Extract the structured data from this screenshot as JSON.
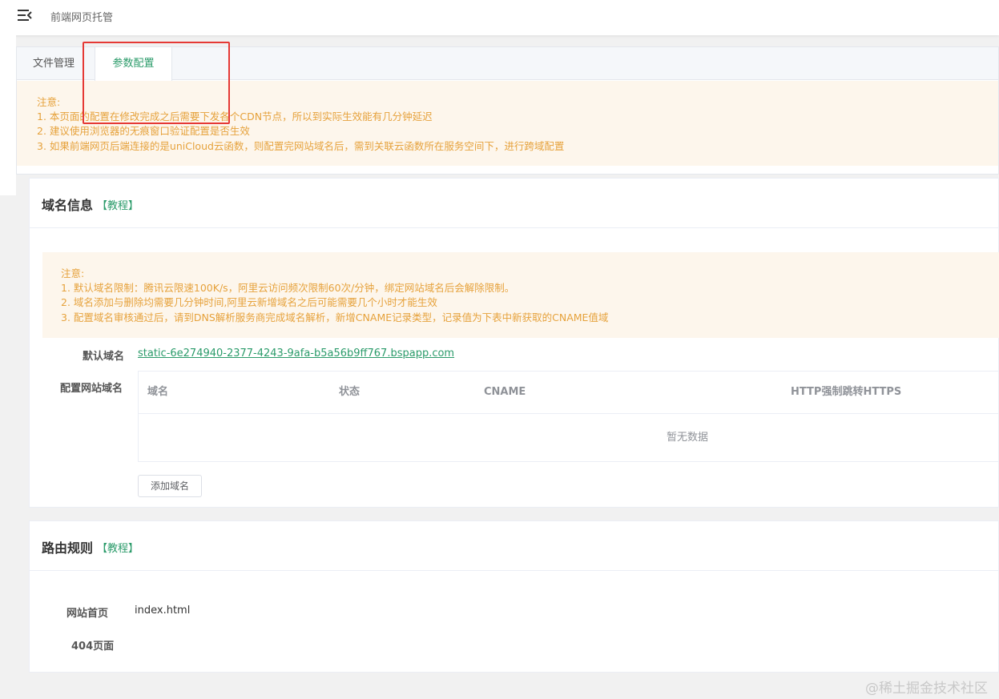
{
  "header": {
    "menu_icon": "menu-fold-icon",
    "breadcrumb": "前端网页托管"
  },
  "tabs": [
    {
      "label": "文件管理",
      "active": false
    },
    {
      "label": "参数配置",
      "active": true
    }
  ],
  "top_notice": {
    "title": "注意:",
    "lines": [
      "1. 本页面的配置在修改完成之后需要下发各个CDN节点，所以到实际生效能有几分钟延迟",
      "2. 建议使用浏览器的无痕窗口验证配置是否生效",
      "3. 如果前端网页后端连接的是uniCloud云函数，则配置完网站域名后，需到关联云函数所在服务空间下，进行跨域配置"
    ]
  },
  "domain_section": {
    "title": "域名信息",
    "tutorial": "【教程】",
    "notice": {
      "title": "注意:",
      "lines": [
        "1. 默认域名限制：腾讯云限速100K/s，阿里云访问频次限制60次/分钟，绑定网站域名后会解除限制。",
        "2. 域名添加与删除均需要几分钟时间,阿里云新增域名之后可能需要几个小时才能生效",
        "3. 配置域名审核通过后，请到DNS解析服务商完成域名解析，新增CNAME记录类型，记录值为下表中新获取的CNAME值域"
      ]
    },
    "default_domain_label": "默认域名",
    "default_domain_value": "static-6e274940-2377-4243-9afa-b5a56b9ff767.bspapp.com",
    "custom_domain_label": "配置网站域名",
    "table": {
      "columns": [
        "域名",
        "状态",
        "CNAME",
        "HTTP强制跳转HTTPS"
      ],
      "empty_text": "暂无数据"
    },
    "add_button": "添加域名"
  },
  "route_section": {
    "title": "路由规则",
    "tutorial": "【教程】",
    "home_label": "网站首页",
    "home_value": "index.html",
    "notfound_label": "404页面",
    "notfound_value": ""
  },
  "watermark": "@稀土掘金技术社区",
  "colors": {
    "accent": "#2b9b6a",
    "warning_text": "#e6a23c",
    "warning_bg": "#fdf6ec",
    "highlight": "#e53935"
  }
}
